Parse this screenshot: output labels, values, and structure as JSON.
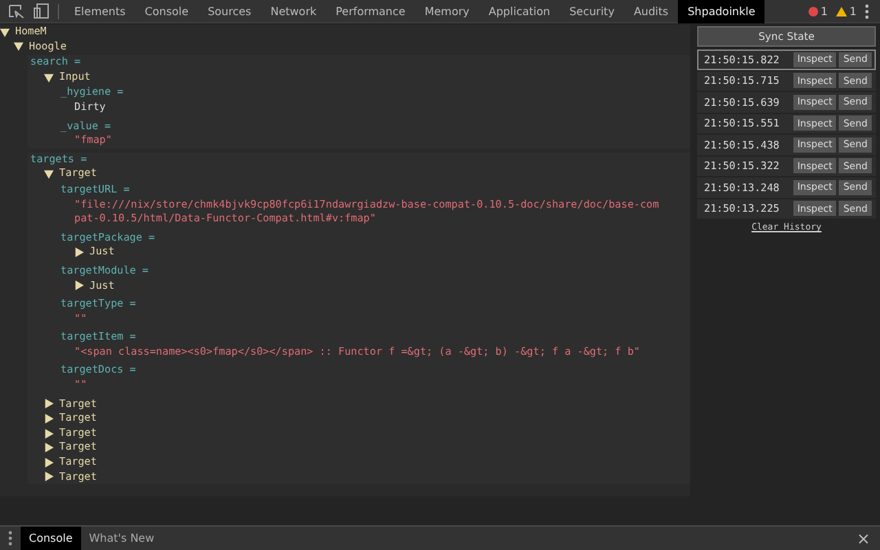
{
  "toolbar": {
    "tabs": [
      {
        "label": "Elements",
        "selected": false
      },
      {
        "label": "Console",
        "selected": false
      },
      {
        "label": "Sources",
        "selected": false
      },
      {
        "label": "Network",
        "selected": false
      },
      {
        "label": "Performance",
        "selected": false
      },
      {
        "label": "Memory",
        "selected": false
      },
      {
        "label": "Application",
        "selected": false
      },
      {
        "label": "Security",
        "selected": false
      },
      {
        "label": "Audits",
        "selected": false
      },
      {
        "label": "Shpadoinkle",
        "selected": true
      }
    ],
    "errors": "1",
    "warnings": "1"
  },
  "tree": [
    {
      "kind": "constructor",
      "label": "HomeM",
      "expanded": true,
      "children": [
        {
          "kind": "constructor",
          "label": "Hoogle",
          "expanded": true,
          "children": [
            {
              "kind": "field",
              "label": "search =",
              "children": [
                {
                  "kind": "constructor",
                  "label": "Input",
                  "expanded": true,
                  "children": [
                    {
                      "kind": "field",
                      "label": "_hygiene =",
                      "children": [
                        {
                          "kind": "plain",
                          "text": "Dirty"
                        }
                      ]
                    },
                    {
                      "kind": "field",
                      "label": "_value =",
                      "children": [
                        {
                          "kind": "string",
                          "text": "\"fmap\""
                        }
                      ]
                    }
                  ]
                }
              ]
            },
            {
              "kind": "field",
              "label": "targets =",
              "children": [
                {
                  "kind": "constructor",
                  "label": "Target",
                  "expanded": true,
                  "children": [
                    {
                      "kind": "field",
                      "label": "targetURL =",
                      "children": [
                        {
                          "kind": "string",
                          "text": "\"file:///nix/store/chmk4bjvk9cp80fcp6i17ndawrgiadzw-base-compat-0.10.5-doc/share/doc/base-compat-0.10.5/html/Data-Functor-Compat.html#v:fmap\""
                        }
                      ]
                    },
                    {
                      "kind": "field",
                      "label": "targetPackage =",
                      "children": [
                        {
                          "kind": "constructor",
                          "label": "Just",
                          "expanded": false
                        }
                      ]
                    },
                    {
                      "kind": "field",
                      "label": "targetModule =",
                      "children": [
                        {
                          "kind": "constructor",
                          "label": "Just",
                          "expanded": false
                        }
                      ]
                    },
                    {
                      "kind": "field",
                      "label": "targetType =",
                      "children": [
                        {
                          "kind": "string",
                          "text": "\"\""
                        }
                      ]
                    },
                    {
                      "kind": "field",
                      "label": "targetItem =",
                      "children": [
                        {
                          "kind": "string",
                          "text": "\"<span class=name><s0>fmap</s0></span> :: Functor f =&gt; (a -&gt; b) -&gt; f a -&gt; f b\""
                        }
                      ]
                    },
                    {
                      "kind": "field",
                      "label": "targetDocs =",
                      "children": [
                        {
                          "kind": "string",
                          "text": "\"\""
                        }
                      ]
                    }
                  ]
                },
                {
                  "kind": "constructor",
                  "label": "Target",
                  "expanded": false
                },
                {
                  "kind": "constructor",
                  "label": "Target",
                  "expanded": false
                },
                {
                  "kind": "constructor",
                  "label": "Target",
                  "expanded": false
                },
                {
                  "kind": "constructor",
                  "label": "Target",
                  "expanded": false
                },
                {
                  "kind": "constructor",
                  "label": "Target",
                  "expanded": false
                },
                {
                  "kind": "constructor",
                  "label": "Target",
                  "expanded": false
                }
              ]
            }
          ]
        }
      ]
    }
  ],
  "history": {
    "sync_button": "Sync State",
    "entries": [
      {
        "time": "21:50:15.822",
        "selected": true,
        "inspect": "Inspect",
        "send": "Send"
      },
      {
        "time": "21:50:15.715",
        "selected": false,
        "inspect": "Inspect",
        "send": "Send"
      },
      {
        "time": "21:50:15.639",
        "selected": false,
        "inspect": "Inspect",
        "send": "Send"
      },
      {
        "time": "21:50:15.551",
        "selected": false,
        "inspect": "Inspect",
        "send": "Send"
      },
      {
        "time": "21:50:15.438",
        "selected": false,
        "inspect": "Inspect",
        "send": "Send"
      },
      {
        "time": "21:50:15.322",
        "selected": false,
        "inspect": "Inspect",
        "send": "Send"
      },
      {
        "time": "21:50:13.248",
        "selected": false,
        "inspect": "Inspect",
        "send": "Send"
      },
      {
        "time": "21:50:13.225",
        "selected": false,
        "inspect": "Inspect",
        "send": "Send"
      }
    ],
    "clear_link": "Clear History"
  },
  "drawer": {
    "tabs": [
      {
        "label": "Console",
        "selected": true
      },
      {
        "label": "What's New",
        "selected": false
      }
    ]
  }
}
